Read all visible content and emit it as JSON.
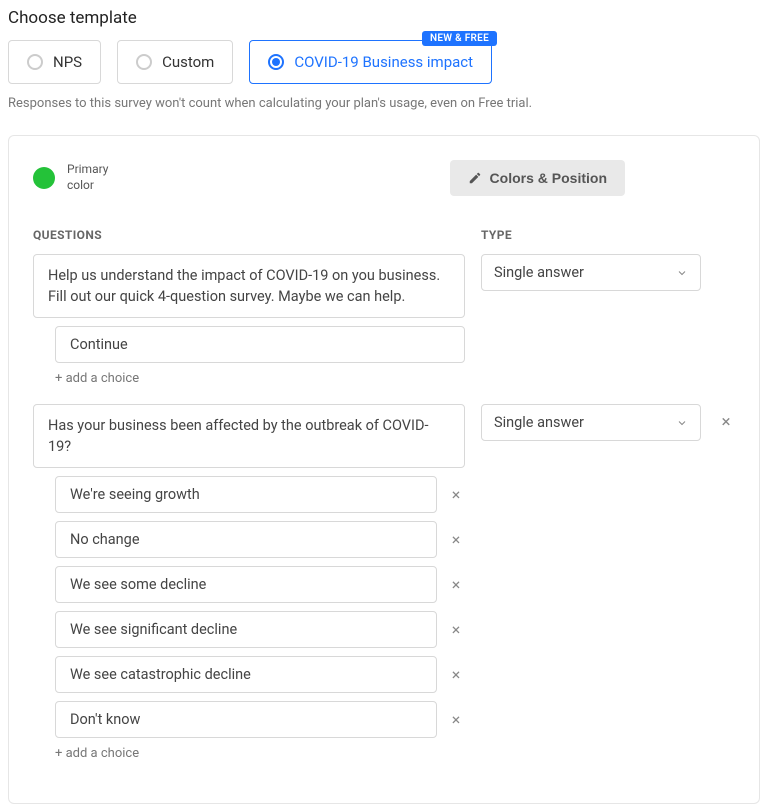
{
  "heading": "Choose template",
  "templates": [
    {
      "label": "NPS",
      "selected": false
    },
    {
      "label": "Custom",
      "selected": false
    },
    {
      "label": "COVID-19 Business impact",
      "selected": true,
      "badge": "NEW & FREE"
    }
  ],
  "note": "Responses to this survey won't count when calculating your plan's usage, even on Free trial.",
  "primary_color": {
    "label": "Primary color",
    "value": "#24c239"
  },
  "colors_btn": "Colors & Position",
  "col_questions": "QUESTIONS",
  "col_type": "TYPE",
  "add_choice": "+ add a choice",
  "questions": [
    {
      "text": "Help us understand the impact of COVID-19 on you business. Fill out our quick 4-question survey. Maybe we can help.",
      "type": "Single answer",
      "removable": false,
      "choices_removable": false,
      "choices": [
        "Continue"
      ]
    },
    {
      "text": "Has your business been affected by the outbreak of COVID-19?",
      "type": "Single answer",
      "removable": true,
      "choices_removable": true,
      "choices": [
        "We're seeing growth",
        "No change",
        "We see some decline",
        "We see significant decline",
        "We see catastrophic decline",
        "Don't know"
      ]
    }
  ]
}
